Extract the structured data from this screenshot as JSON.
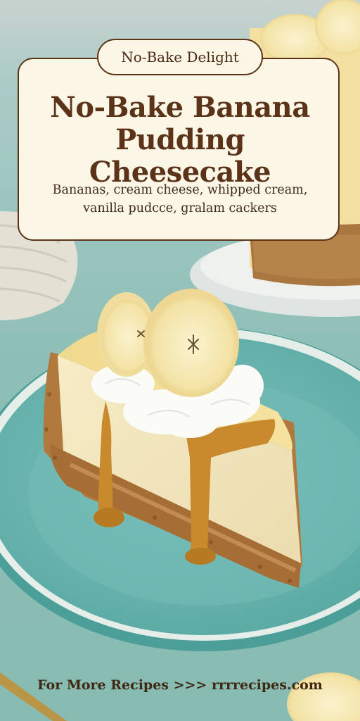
{
  "badge": {
    "label": "No-Bake Delight"
  },
  "title": {
    "line1": "No-Bake Banana",
    "line2": "Pudding Cheesecake"
  },
  "subtitle": {
    "line1": "Bananas, cream cheese, whipped cream,",
    "line2": "vanilla pudcce, gralam cackers"
  },
  "footer": {
    "text": "For More Recipes >>> rrrrecipes.com"
  }
}
